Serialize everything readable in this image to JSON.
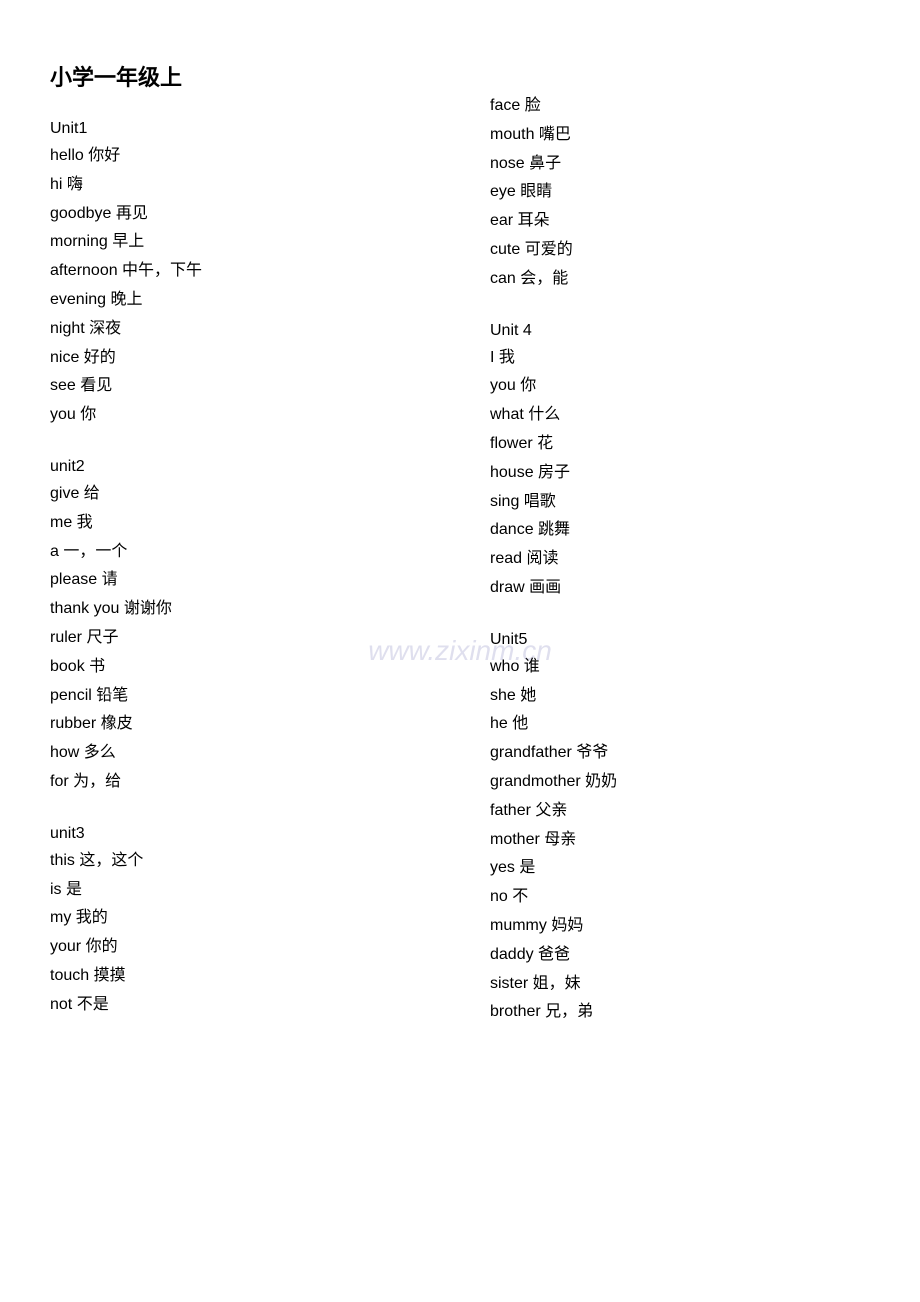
{
  "watermark": "www.zixinm.cn",
  "left_column": {
    "title": "小学一年级上",
    "sections": [
      {
        "heading": "Unit1",
        "items": [
          "hello  你好",
          "hi 嗨",
          "goodbye  再见",
          "morning  早上",
          "afternoon 中午，下午",
          "evening 晚上",
          "night 深夜",
          "nice 好的",
          "see 看见",
          "you  你"
        ]
      },
      {
        "heading": "unit2",
        "items": [
          "give 给",
          "me 我",
          "a  一，一个",
          "please 请",
          "thank you  谢谢你",
          "ruler  尺子",
          "book 书",
          "pencil  铅笔",
          "rubber 橡皮",
          "how 多么",
          "for  为，给"
        ]
      },
      {
        "heading": "unit3",
        "items": [
          "this 这，这个",
          "is 是",
          "my  我的",
          "your  你的",
          "touch  摸摸",
          "not 不是"
        ]
      }
    ]
  },
  "right_column": {
    "sections": [
      {
        "heading": "",
        "items": [
          "face 脸",
          "mouth 嘴巴",
          "nose  鼻子",
          "eye  眼睛",
          "ear  耳朵",
          "cute  可爱的",
          "can 会，能"
        ]
      },
      {
        "heading": "Unit 4",
        "items": [
          "I  我",
          "you  你",
          "what 什么",
          "flower 花",
          "house 房子",
          "sing  唱歌",
          "dance  跳舞",
          "read 阅读",
          "draw 画画"
        ]
      },
      {
        "heading": "Unit5",
        "items": [
          "who  谁",
          "she 她",
          "he 他",
          "grandfather 爷爷",
          "grandmother  奶奶",
          "father  父亲",
          "mother 母亲",
          "yes 是",
          "no  不",
          "mummy 妈妈",
          "daddy 爸爸",
          "sister 姐，妹",
          "brother  兄，弟"
        ]
      }
    ]
  }
}
